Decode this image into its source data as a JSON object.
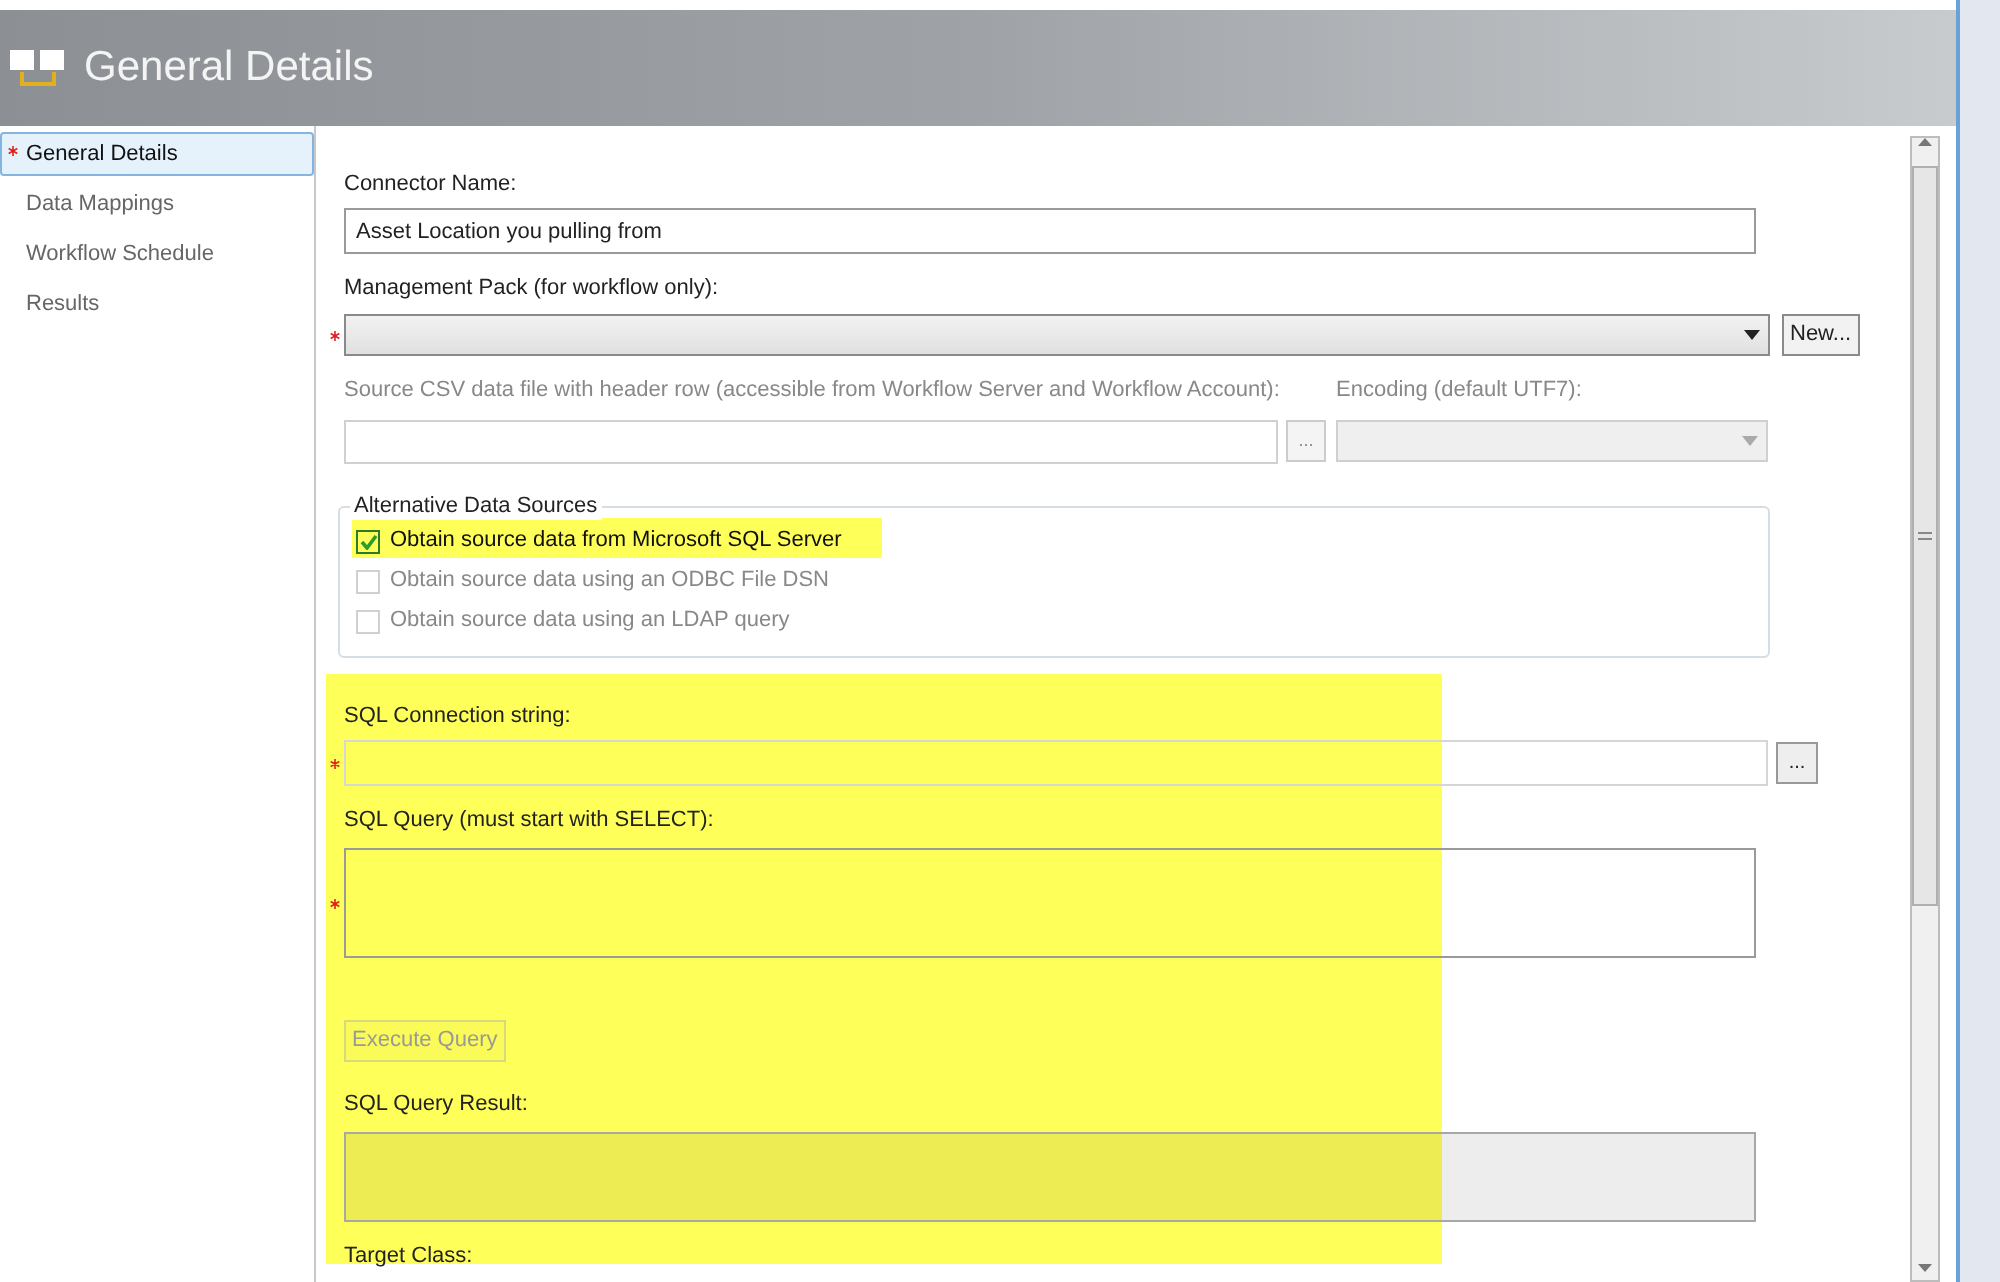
{
  "header": {
    "title": "General Details"
  },
  "nav": [
    {
      "label": "General Details",
      "selected": true,
      "required": true
    },
    {
      "label": "Data Mappings",
      "selected": false
    },
    {
      "label": "Workflow Schedule",
      "selected": false
    },
    {
      "label": "Results",
      "selected": false
    }
  ],
  "form": [
    {
      "kind": "text",
      "label": "Connector Name:",
      "value": "Asset Location you pulling from"
    },
    {
      "kind": "dropdown",
      "label": "Management Pack (for workflow only):",
      "required": true,
      "button": "New..."
    },
    {
      "kind": "file",
      "label": "Source CSV data file with header row (accessible from Workflow Server and Workflow Account):",
      "browse": "...",
      "encoding_label": "Encoding (default UTF7):",
      "disabled": true
    },
    {
      "kind": "group",
      "title": "Alternative Data Sources",
      "options": [
        {
          "label": "Obtain source data from Microsoft SQL Server",
          "checked": true,
          "disabled": false
        },
        {
          "label": "Obtain source data using an ODBC File DSN",
          "checked": false,
          "disabled": true
        },
        {
          "label": "Obtain source data using an LDAP query",
          "checked": false,
          "disabled": true
        }
      ]
    },
    {
      "kind": "text",
      "label": "SQL Connection string:",
      "required": true,
      "browse": "..."
    },
    {
      "kind": "textarea",
      "label": "SQL Query (must start with SELECT):",
      "required": true
    },
    {
      "kind": "button",
      "label": "Execute Query",
      "disabled": true
    },
    {
      "kind": "readonly",
      "label": "SQL Query Result:"
    },
    {
      "kind": "label",
      "label": "Target Class:"
    }
  ]
}
